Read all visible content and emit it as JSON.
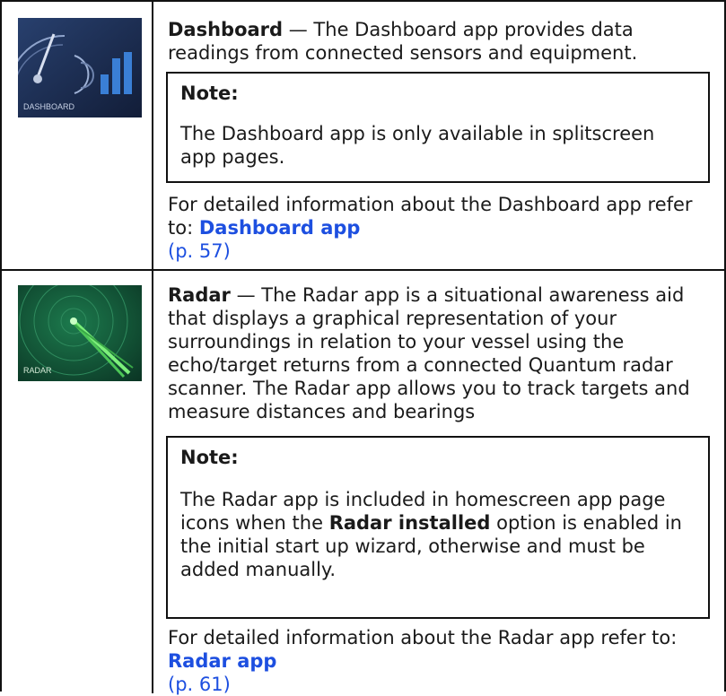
{
  "rows": [
    {
      "thumbnail": {
        "label": "DASHBOARD",
        "icon": "dashboard-app-icon"
      },
      "title": "Dashboard",
      "desc": " — The Dashboard app provides data readings from connected sensors and equipment.",
      "note": {
        "title": "Note:",
        "body": "The Dashboard app is only available in splitscreen app pages."
      },
      "refer": "For detailed information about the Dashboard app refer to: ",
      "link": "Dashboard app",
      "page": "(p. 57)"
    },
    {
      "thumbnail": {
        "label": "RADAR",
        "icon": "radar-app-icon"
      },
      "title": "Radar",
      "desc": " — The Radar app is a situational awareness aid that displays a graphical representation of your surroundings in relation to your vessel using the echo/target returns from a connected Quantum radar scanner.  The Radar app allows you to track targets and measure distances and bearings",
      "note": {
        "title": "Note:",
        "body_pre": "The Radar app is included in homescreen app page icons when the ",
        "body_bold": "Radar installed",
        "body_post": " option is enabled in the initial start up wizard, otherwise and must be added manually."
      },
      "refer": "For detailed information about the Radar app refer to: ",
      "link": "Radar app",
      "page": "(p. 61)"
    }
  ],
  "colors": {
    "link": "#1d4fe0",
    "dashboard_bg": "#1b2b4e",
    "radar_bg": "#0f4a32"
  }
}
